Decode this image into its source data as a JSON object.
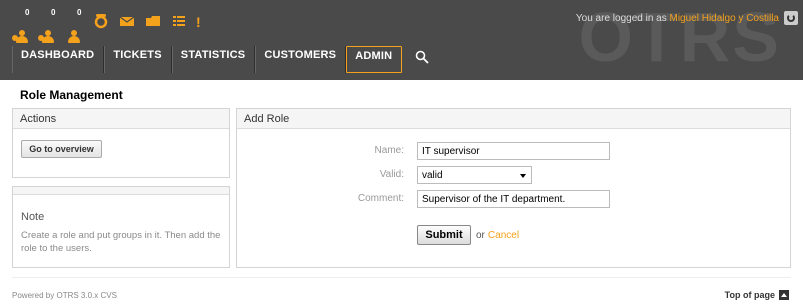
{
  "header": {
    "toolbar": [
      {
        "icon": "locked-tickets-new-icon",
        "badge": "0"
      },
      {
        "icon": "locked-tickets-reminder-icon",
        "badge": "0"
      },
      {
        "icon": "locked-tickets-all-icon",
        "badge": "0"
      },
      {
        "icon": "phone-ticket-icon",
        "badge": ""
      },
      {
        "icon": "email-ticket-icon",
        "badge": ""
      },
      {
        "icon": "queue-view-icon",
        "badge": ""
      },
      {
        "icon": "status-view-icon",
        "badge": ""
      },
      {
        "icon": "escalation-view-icon",
        "badge": ""
      }
    ],
    "logo_text": "OTRS",
    "login_prefix": "You are logged in as ",
    "login_user": "Miguel Hidalgo y Costilla",
    "nav": {
      "dashboard": "DASHBOARD",
      "tickets": "TICKETS",
      "statistics": "STATISTICS",
      "customers": "CUSTOMERS",
      "admin": "ADMIN"
    },
    "accent_color": "#f4a11c"
  },
  "page": {
    "title": "Role Management"
  },
  "sidebar": {
    "actions_title": "Actions",
    "overview_button": "Go to overview",
    "note_title": "Note",
    "note_text": "Create a role and put groups in it. Then add the role to the users."
  },
  "form": {
    "title": "Add Role",
    "name_label": "Name:",
    "name_value": "IT supervisor",
    "valid_label": "Valid:",
    "valid_value": "valid",
    "comment_label": "Comment:",
    "comment_value": "Supervisor of the IT department.",
    "submit_label": "Submit",
    "or_text": "or",
    "cancel_label": "Cancel"
  },
  "footer": {
    "powered": "Powered by OTRS 3.0.x CVS",
    "top_link": "Top of page"
  }
}
